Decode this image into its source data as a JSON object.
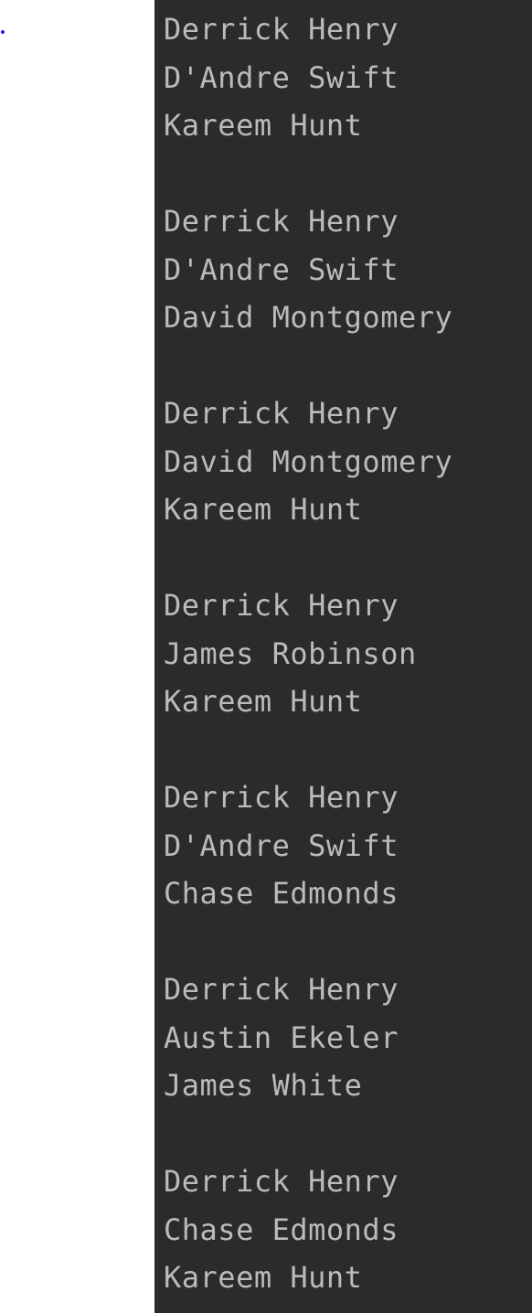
{
  "console": {
    "groups": [
      [
        "Derrick Henry",
        "D'Andre Swift",
        "Kareem Hunt"
      ],
      [
        "Derrick Henry",
        "D'Andre Swift",
        "David Montgomery"
      ],
      [
        "Derrick Henry",
        "David Montgomery",
        "Kareem Hunt"
      ],
      [
        "Derrick Henry",
        "James Robinson",
        "Kareem Hunt"
      ],
      [
        "Derrick Henry",
        "D'Andre Swift",
        "Chase Edmonds"
      ],
      [
        "Derrick Henry",
        "Austin Ekeler",
        "James White"
      ],
      [
        "Derrick Henry",
        "Chase Edmonds",
        "Kareem Hunt"
      ]
    ]
  }
}
